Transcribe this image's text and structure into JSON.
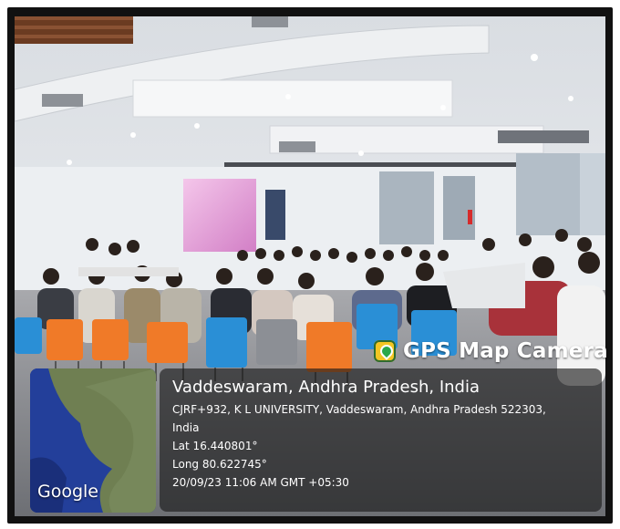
{
  "overlay": {
    "brand_label": "GPS Map Camera",
    "map_attribution": "Google",
    "location_title": "Vaddeswaram, Andhra Pradesh, India",
    "address_line1": "CJRF+932, K L UNIVERSITY, Vaddeswaram, Andhra Pradesh 522303,",
    "address_line2": "India",
    "latitude": "Lat 16.440801°",
    "longitude": "Long 80.622745°",
    "timestamp": "20/09/23 11:06 AM GMT +05:30"
  },
  "colors": {
    "chair_orange": "#f07a28",
    "chair_blue": "#2a8fd6",
    "ceiling": "#e9ecef",
    "projection": "#e7a6d8"
  }
}
